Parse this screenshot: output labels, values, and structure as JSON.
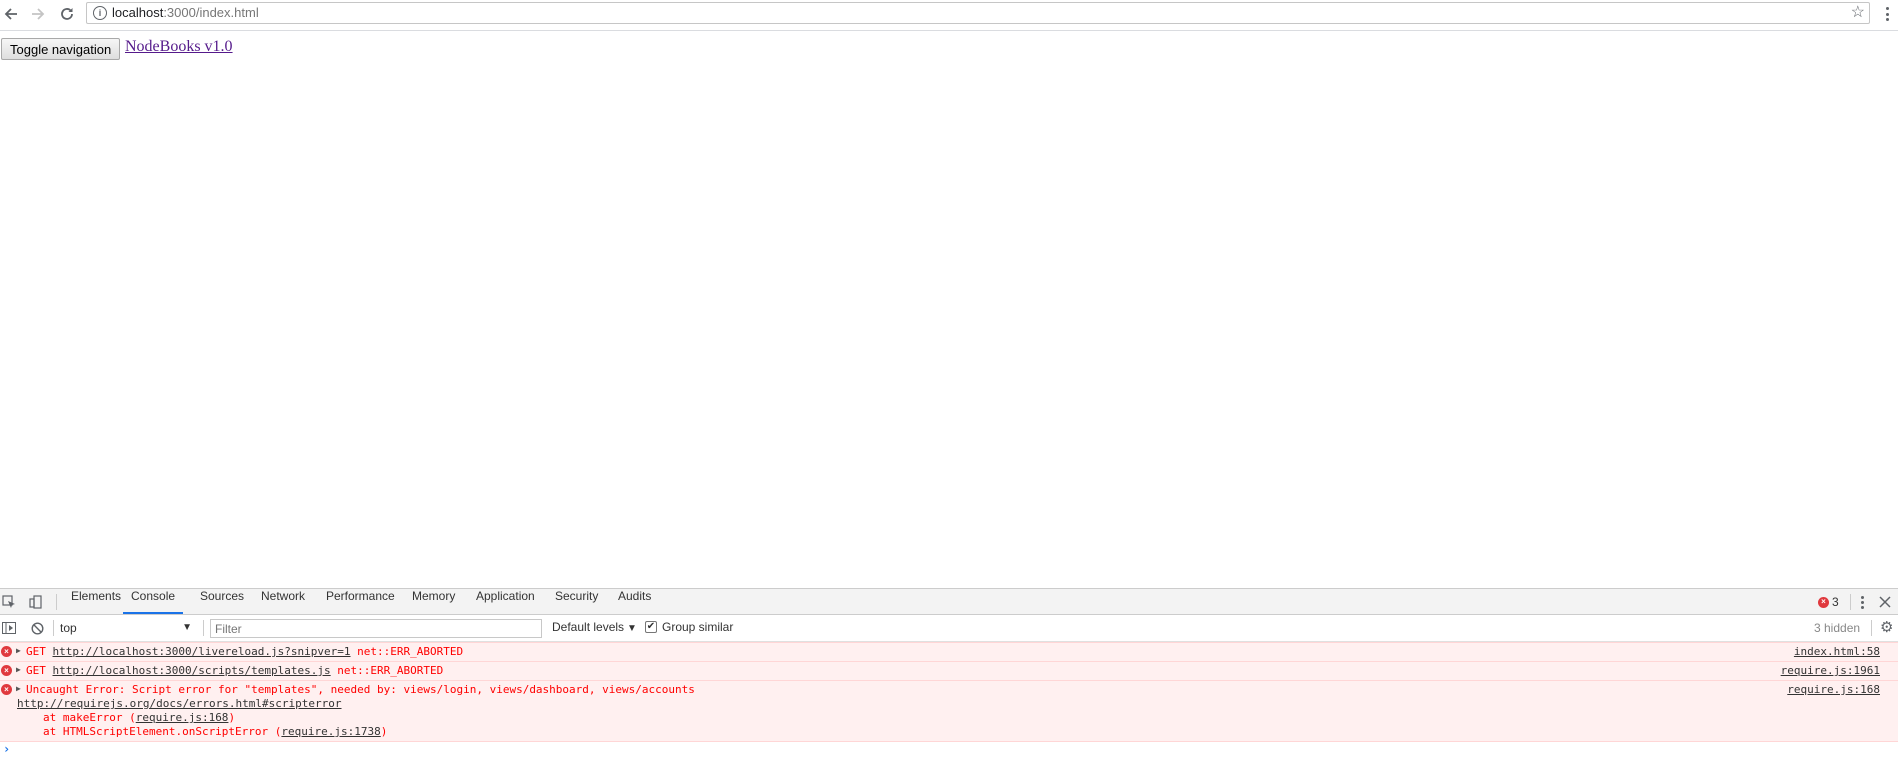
{
  "browser": {
    "back_icon": "arrow-left-icon",
    "forward_icon": "arrow-right-icon",
    "reload_icon": "reload-icon",
    "url_host": "localhost",
    "url_rest": ":3000/index.html",
    "star_icon": "star-icon",
    "menu_icon": "kebab-menu-icon"
  },
  "page": {
    "toggle_button": "Toggle navigation",
    "brand_link": "NodeBooks v1.0"
  },
  "devtools": {
    "tabs": [
      "Elements",
      "Console",
      "Sources",
      "Network",
      "Performance",
      "Memory",
      "Application",
      "Security",
      "Audits"
    ],
    "active_tab": "Console",
    "error_count": "3",
    "toolbar": {
      "context": "top",
      "filter_placeholder": "Filter",
      "levels": "Default levels",
      "group_similar_label": "Group similar",
      "group_similar_checked": true,
      "hidden_count": "3 hidden"
    },
    "messages": [
      {
        "prefix": "GET ",
        "url": "http://localhost:3000/livereload.js?snipver=1",
        "suffix": " net::ERR_ABORTED",
        "source": "index.html:58"
      },
      {
        "prefix": "GET ",
        "url": "http://localhost:3000/scripts/templates.js",
        "suffix": " net::ERR_ABORTED",
        "source": "require.js:1961"
      },
      {
        "text": "Uncaught Error: Script error for \"templates\", needed by: views/login, views/dashboard, views/accounts",
        "doc_url": "http://requirejs.org/docs/errors.html#scripterror",
        "stack1_prefix": "at makeError (",
        "stack1_link": "require.js:168",
        "stack1_suffix": ")",
        "stack2_prefix": "at HTMLScriptElement.onScriptError (",
        "stack2_link": "require.js:1738",
        "stack2_suffix": ")",
        "source": "require.js:168"
      }
    ],
    "error_icon_glyph": "×",
    "expand_glyph": "▶",
    "prompt_glyph": "›"
  },
  "colors": {
    "error_red": "#ff0000",
    "error_bg": "#fff0f0",
    "active_tab_underline": "#1a73e8",
    "visited_link": "#551a8b"
  }
}
